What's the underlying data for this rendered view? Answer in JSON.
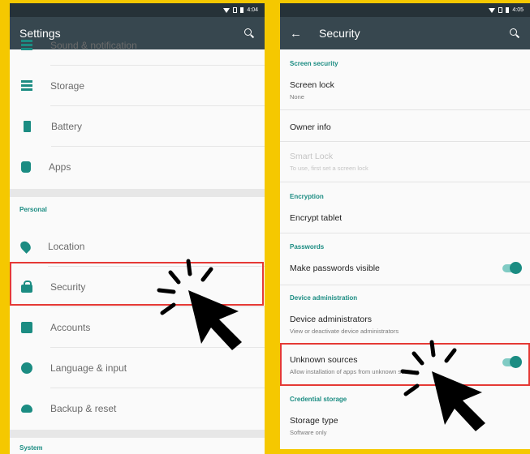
{
  "left": {
    "status_time": "4:04",
    "title": "Settings",
    "cut_item": "Sound & notification",
    "items_top": [
      {
        "label": "Storage",
        "icon": "storage-icon"
      },
      {
        "label": "Battery",
        "icon": "battery-icon"
      },
      {
        "label": "Apps",
        "icon": "apps-icon"
      }
    ],
    "personal_header": "Personal",
    "items_personal": [
      {
        "label": "Location",
        "icon": "location-icon"
      },
      {
        "label": "Security",
        "icon": "lock-icon"
      },
      {
        "label": "Accounts",
        "icon": "account-icon"
      },
      {
        "label": "Language & input",
        "icon": "globe-icon"
      },
      {
        "label": "Backup & reset",
        "icon": "cloud-icon"
      }
    ],
    "system_header": "System"
  },
  "right": {
    "status_time": "4:05",
    "title": "Security",
    "screen_security_header": "Screen security",
    "screen_lock": {
      "title": "Screen lock",
      "sub": "None"
    },
    "owner_info": "Owner info",
    "smart_lock": {
      "title": "Smart Lock",
      "sub": "To use, first set a screen lock"
    },
    "encryption_header": "Encryption",
    "encrypt_tablet": "Encrypt tablet",
    "passwords_header": "Passwords",
    "make_passwords_visible": "Make passwords visible",
    "device_admin_header": "Device administration",
    "device_admins": {
      "title": "Device administrators",
      "sub": "View or deactivate device administrators"
    },
    "unknown_sources": {
      "title": "Unknown sources",
      "sub": "Allow installation of apps from unknown sources"
    },
    "credential_header": "Credential storage",
    "storage_type": {
      "title": "Storage type",
      "sub": "Software only"
    }
  },
  "colors": {
    "accent": "#1b8c82",
    "appbar": "#37474f",
    "highlight": "#e53935",
    "frame": "#f5c800"
  }
}
